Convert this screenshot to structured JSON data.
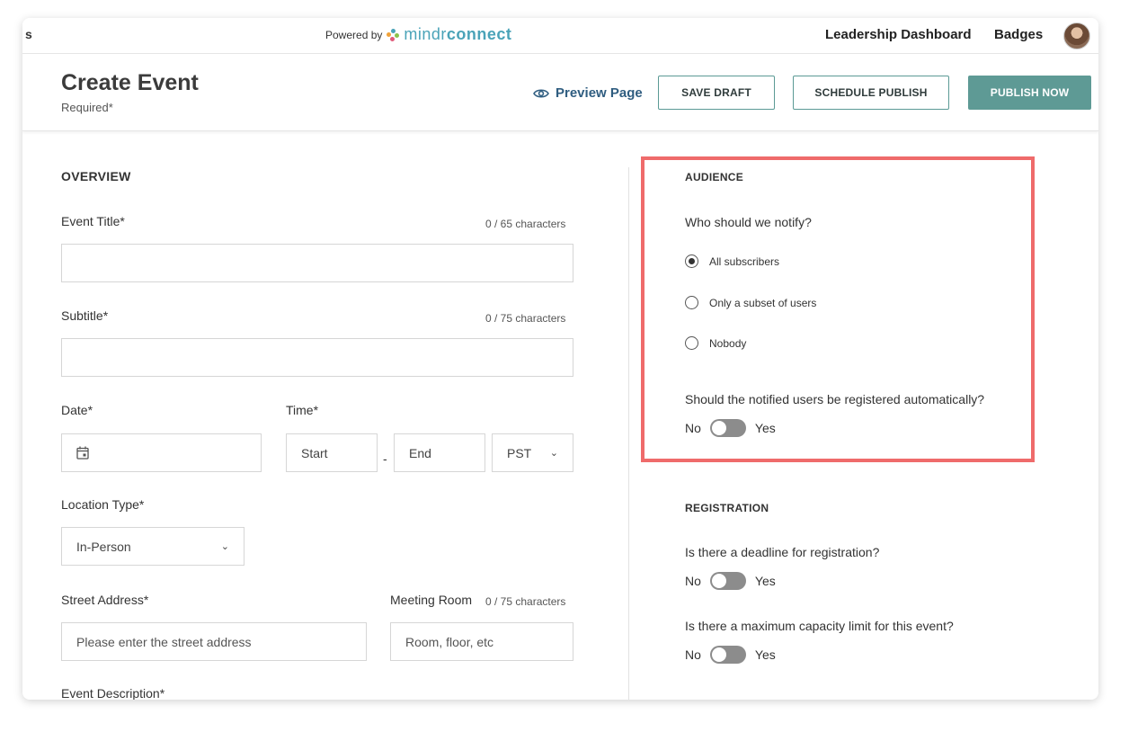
{
  "topbar": {
    "cut_text": "s",
    "powered_by": "Powered by",
    "brand_part1": "mindr",
    "brand_part2": "connect",
    "nav_leadership": "Leadership Dashboard",
    "nav_badges": "Badges"
  },
  "header": {
    "title": "Create Event",
    "subtitle": "Required*",
    "preview_label": "Preview Page",
    "save_draft": "SAVE DRAFT",
    "schedule_publish": "SCHEDULE PUBLISH",
    "publish_now": "PUBLISH NOW"
  },
  "overview": {
    "section_title": "OVERVIEW",
    "event_title_label": "Event Title*",
    "event_title_counter": "0 / 65 characters",
    "event_title_value": "",
    "subtitle_label": "Subtitle*",
    "subtitle_counter": "0 / 75 characters",
    "subtitle_value": "",
    "date_label": "Date*",
    "time_label": "Time*",
    "time_start": "Start",
    "time_separator": "-",
    "time_end": "End",
    "timezone": "PST",
    "location_type_label": "Location Type*",
    "location_type_value": "In-Person",
    "street_label": "Street Address*",
    "street_placeholder": "Please enter the street address",
    "room_label": "Meeting Room",
    "room_counter": "0 / 75 characters",
    "room_placeholder": "Room, floor, etc",
    "description_label": "Event Description*"
  },
  "audience": {
    "section_title": "AUDIENCE",
    "question": "Who should we notify?",
    "options": [
      "All subscribers",
      "Only a subset of users",
      "Nobody"
    ],
    "selected": "All subscribers",
    "auto_register_question": "Should the notified users be registered automatically?",
    "toggle_no": "No",
    "toggle_yes": "Yes"
  },
  "registration": {
    "section_title": "REGISTRATION",
    "deadline_question": "Is there a deadline for registration?",
    "capacity_question": "Is there a maximum capacity limit for this event?",
    "toggle_no": "No",
    "toggle_yes": "Yes"
  },
  "colors": {
    "accent": "#5e9a95",
    "brand": "#4aa3b8",
    "link": "#2f5d80",
    "highlight": "#ef6b6b"
  },
  "icons": {
    "preview": "eye-icon",
    "date": "calendar-icon",
    "dropdown": "chevron-down-icon"
  }
}
